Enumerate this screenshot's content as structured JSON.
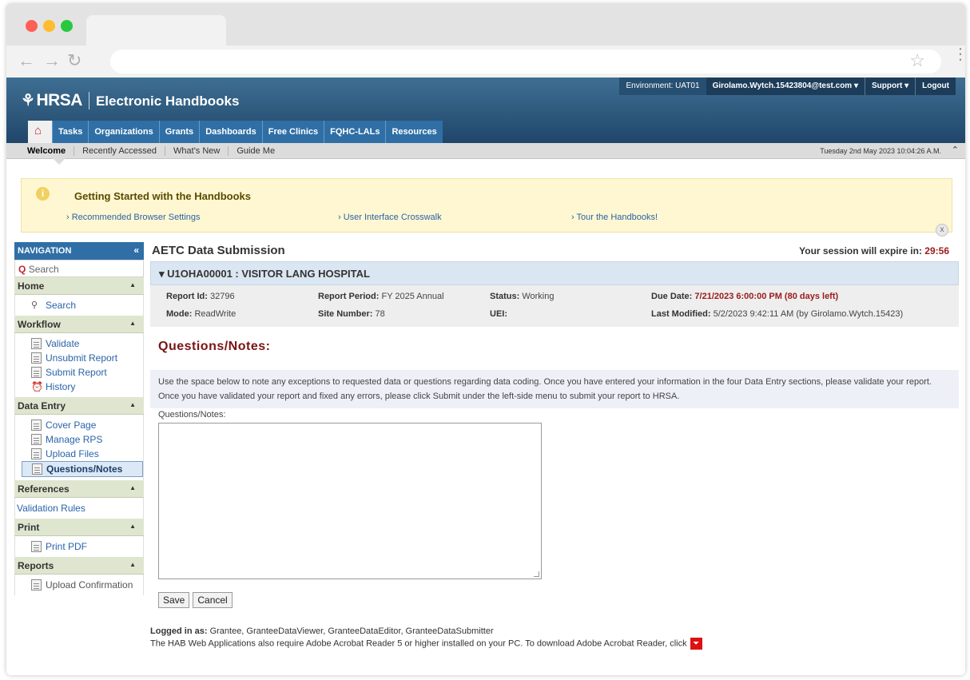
{
  "header": {
    "logo_text": "HRSA",
    "app_title": "Electronic Handbooks",
    "environment": "Environment: UAT01",
    "user": "Girolamo.Wytch.15423804@test.com ▾",
    "support": "Support ▾",
    "logout": "Logout"
  },
  "mainnav": [
    "Tasks",
    "Organizations",
    "Grants",
    "Dashboards",
    "Free Clinics",
    "FQHC-LALs",
    "Resources"
  ],
  "subnav": {
    "links": [
      "Welcome",
      "Recently Accessed",
      "What's New",
      "Guide Me"
    ],
    "date": "Tuesday 2nd May 2023 10:04:26 A.M."
  },
  "banner": {
    "title": "Getting Started with the Handbooks",
    "links": [
      "› Recommended Browser Settings",
      "› User Interface Crosswalk",
      "› Tour the Handbooks!"
    ],
    "close": "x"
  },
  "sidebar": {
    "title": "NAVIGATION",
    "search_placeholder": "Search",
    "sections": [
      {
        "title": "Home",
        "items": [
          {
            "label": "Search"
          }
        ]
      },
      {
        "title": "Workflow",
        "items": [
          {
            "label": "Validate"
          },
          {
            "label": "Unsubmit Report"
          },
          {
            "label": "Submit Report"
          },
          {
            "label": "History"
          }
        ]
      },
      {
        "title": "Data Entry",
        "items": [
          {
            "label": "Cover Page"
          },
          {
            "label": "Manage RPS"
          },
          {
            "label": "Upload Files"
          },
          {
            "label": "Questions/Notes"
          }
        ]
      },
      {
        "title": "References",
        "items": [
          {
            "label": "Validation Rules"
          }
        ]
      },
      {
        "title": "Print",
        "items": [
          {
            "label": "Print PDF"
          }
        ]
      },
      {
        "title": "Reports",
        "items": [
          {
            "label": "Upload Confirmation"
          }
        ]
      }
    ]
  },
  "main": {
    "title": "AETC Data Submission",
    "session_label": "Your session will expire in:",
    "session_time": "29:56",
    "grant": "▾ U1OHA00001 : VISITOR LANG HOSPITAL",
    "details": {
      "report_id_label": "Report Id:",
      "report_id": "32796",
      "mode_label": "Mode:",
      "mode": "ReadWrite",
      "period_label": "Report Period:",
      "period": "FY 2025 Annual",
      "site_label": "Site Number:",
      "site": "78",
      "status_label": "Status:",
      "status": "Working",
      "uei_label": "UEI:",
      "uei": "",
      "due_label": "Due Date:",
      "due": "7/21/2023 6:00:00 PM (80 days left)",
      "modified_label": "Last Modified:",
      "modified": "5/2/2023 9:42:11 AM (by Girolamo.Wytch.15423)"
    },
    "section_title": "Questions/Notes:",
    "instructions": "Use the space below to note any exceptions to requested data or questions regarding data coding. Once you have entered your information in the four Data Entry sections, please validate your report. Once you have validated your report and fixed any errors, please click Submit under the left-side menu to submit your report to HRSA.",
    "field_label": "Questions/Notes:",
    "field_value": "",
    "save": "Save",
    "cancel": "Cancel"
  },
  "footer": {
    "logged_label": "Logged in as:",
    "roles": "Grantee, GranteeDataViewer, GranteeDataEditor, GranteeDataSubmitter",
    "acrobat": "The HAB Web Applications also require Adobe Acrobat Reader 5 or higher installed on your PC. To download Adobe Acrobat Reader, click"
  },
  "colors": {
    "brand": "#2f6fa6",
    "accent_red": "#9a1b1b",
    "banner": "#fff7d1"
  }
}
